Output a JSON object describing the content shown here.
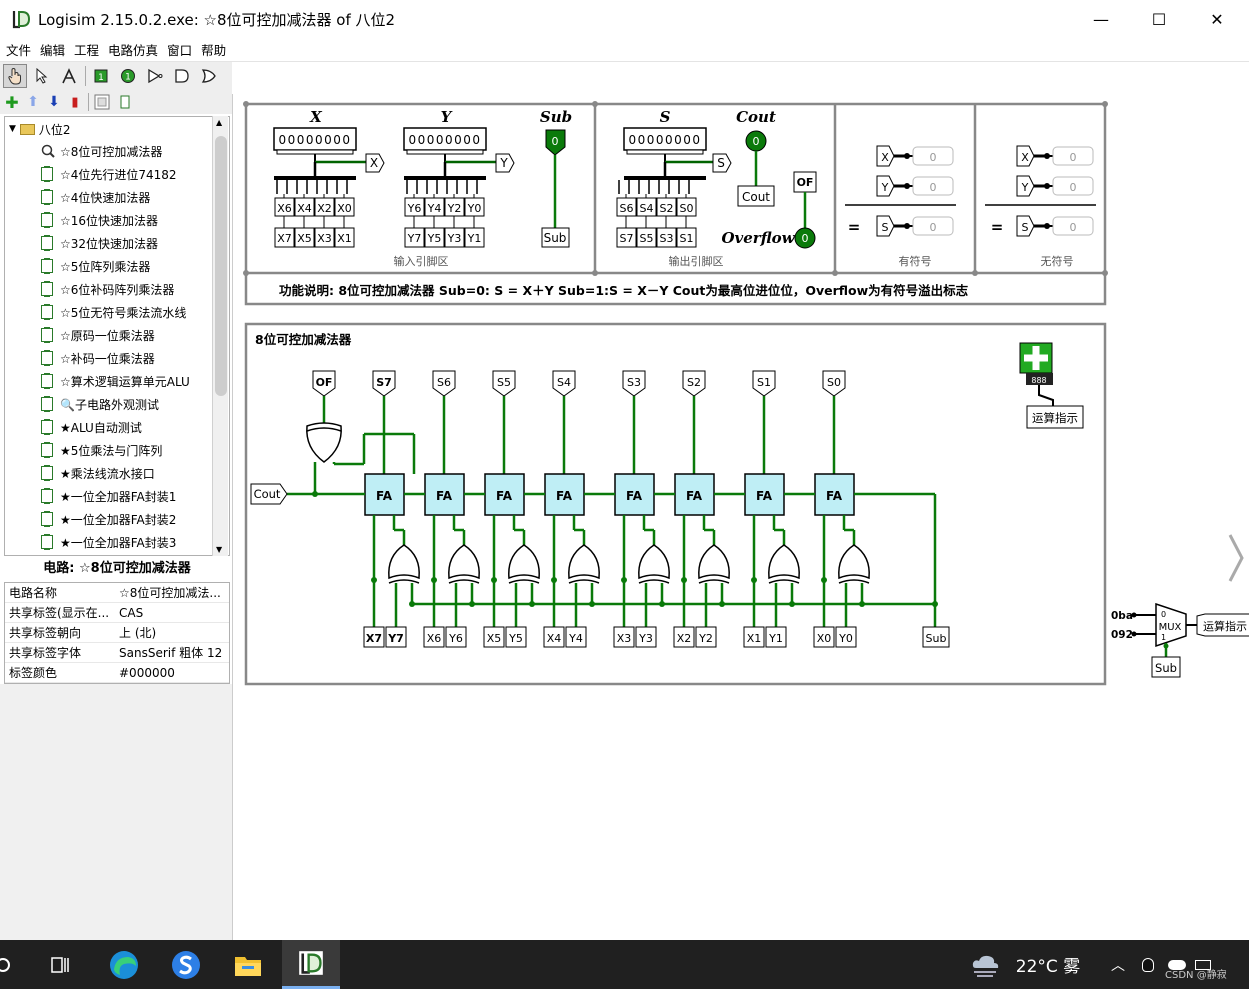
{
  "window": {
    "title": "Logisim 2.15.0.2.exe: ☆8位可控加减法器 of 八位2",
    "minimize": "—",
    "maximize": "☐",
    "close": "✕"
  },
  "menu": [
    "文件",
    "编辑",
    "工程",
    "电路仿真",
    "窗口",
    "帮助"
  ],
  "tree": {
    "root": "八位2",
    "items": [
      "☆8位可控加减法器",
      "☆4位先行进位74182",
      "☆4位快速加法器",
      "☆16位快速加法器",
      "☆32位快速加法器",
      "☆5位阵列乘法器",
      "☆6位补码阵列乘法器",
      "☆5位无符号乘法流水线",
      "☆原码一位乘法器",
      "☆补码一位乘法器",
      "☆算术逻辑运算单元ALU",
      "🔍子电路外观测试",
      "★ALU自动测试",
      "★5位乘法与门阵列",
      "★乘法线流水接口",
      "★一位全加器FA封装1",
      "★一位全加器FA封装2",
      "★一位全加器FA封装3"
    ]
  },
  "props": {
    "title": "电路: ☆8位可控加减法器",
    "rows": [
      {
        "k": "电路名称",
        "v": "☆8位可控加减法..."
      },
      {
        "k": "共享标签(显示在...",
        "v": "CAS"
      },
      {
        "k": "共享标签朝向",
        "v": "上 (北)"
      },
      {
        "k": "共享标签字体",
        "v": "SansSerif 粗体 12"
      },
      {
        "k": "标签颜色",
        "v": "#000000"
      }
    ]
  },
  "canvas": {
    "x_label": "X",
    "y_label": "Y",
    "sub_label": "Sub",
    "s_label": "S",
    "cout_label": "Cout",
    "overflow_label": "Overflow",
    "of_label": "OF",
    "x_value": "00000000",
    "y_value": "00000000",
    "s_value": "00000000",
    "sub_value": "0",
    "cout_value": "0",
    "of_value": "0",
    "x_bits_top": [
      "X6",
      "X4",
      "X2",
      "X0"
    ],
    "x_bits_bot": [
      "X7",
      "X5",
      "X3",
      "X1"
    ],
    "y_bits_top": [
      "Y6",
      "Y4",
      "Y2",
      "Y0"
    ],
    "y_bits_bot": [
      "Y7",
      "Y5",
      "Y3",
      "Y1"
    ],
    "s_bits_top": [
      "S6",
      "S4",
      "S2",
      "S0"
    ],
    "s_bits_bot": [
      "S7",
      "S5",
      "S3",
      "S1"
    ],
    "input_zone": "输入引脚区",
    "output_zone": "输出引脚区",
    "signed_zone": "有符号",
    "unsigned_zone": "无符号",
    "zero": "0",
    "eq": "=",
    "desc": "功能说明:   8位可控加减法器    Sub=0: S = X＋Y   Sub=1:S = X－Y    Cout为最高位进位位，Overflow为有符号溢出标志",
    "circuit_title": "8位可控加减法器",
    "outputs": [
      "OF",
      "S7",
      "S6",
      "S5",
      "S4",
      "S3",
      "S2",
      "S1",
      "S0"
    ],
    "fa": "FA",
    "bottom_pins": [
      "X7",
      "Y7",
      "X6",
      "Y6",
      "X5",
      "Y5",
      "X4",
      "Y4",
      "X3",
      "Y3",
      "X2",
      "Y2",
      "X1",
      "Y1",
      "X0",
      "Y0",
      "Sub"
    ],
    "cout_pin": "Cout",
    "indicator": "运算指示",
    "mux_in0": "0ba",
    "mux_in1": "092",
    "mux": "MUX",
    "mux_sel": "Sub",
    "mux_out": "运算指示"
  },
  "taskbar": {
    "weather": "22°C 雾",
    "watermark": "CSDN @静寂"
  }
}
